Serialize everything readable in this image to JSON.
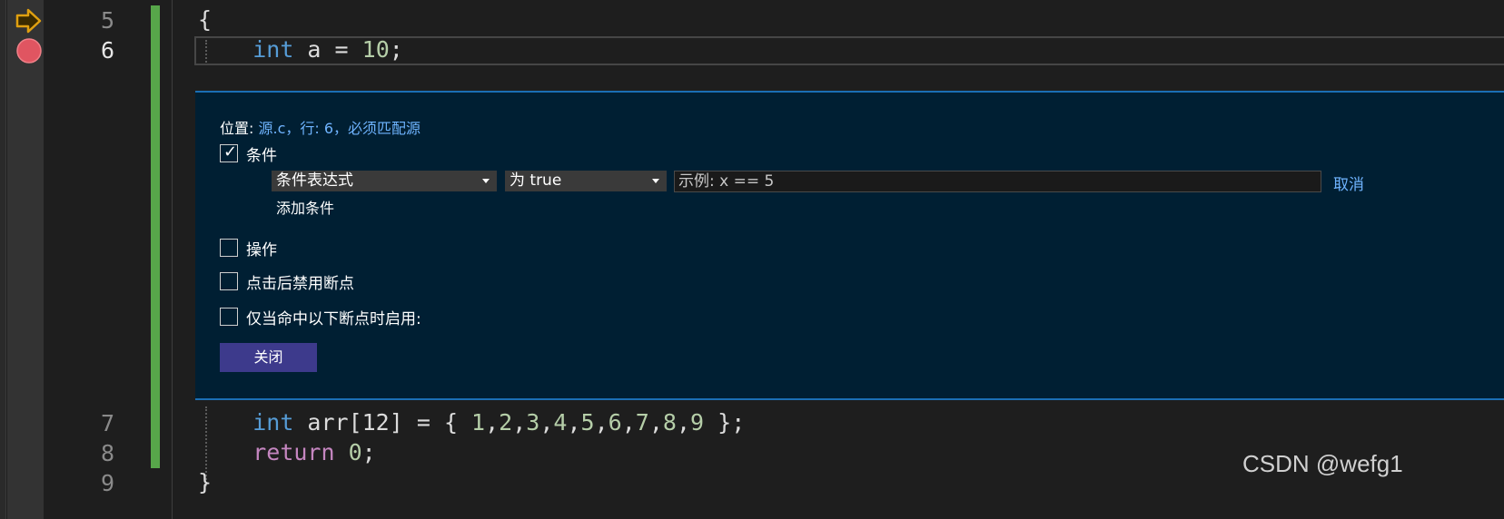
{
  "line_numbers": {
    "l5": "5",
    "l6": "6",
    "l7": "7",
    "l8": "8",
    "l9": "9"
  },
  "code": {
    "l5": "{",
    "l6": {
      "kw": "int",
      "rest": " a = ",
      "num": "10",
      "end": ";"
    },
    "l7": {
      "kw": "int",
      "rest": " arr[12] = { ",
      "nums": [
        "1",
        "2",
        "3",
        "4",
        "5",
        "6",
        "7",
        "8",
        "9"
      ],
      "end": " };"
    },
    "l8": {
      "kw": "return",
      "rest": " ",
      "num": "0",
      "end": ";"
    },
    "l9": "}"
  },
  "breakpoint_settings": {
    "location_label": "位置:",
    "location_link": "源.c，行: 6，必须匹配源",
    "condition": {
      "checked": true,
      "label": "条件"
    },
    "condition_type": "条件表达式",
    "condition_value": "为 true",
    "expression_placeholder": "示例: x == 5",
    "cancel_label": "取消",
    "add_condition_label": "添加条件",
    "action": {
      "checked": false,
      "label": "操作"
    },
    "disable_after_hit": {
      "checked": false,
      "label": "点击后禁用断点"
    },
    "only_enable_when_hit": {
      "checked": false,
      "label": "仅当命中以下断点时启用:"
    },
    "close_label": "关闭"
  },
  "watermark": "CSDN @wefg1",
  "colors": {
    "keyword": "#569cd6",
    "control_keyword": "#c586c0",
    "number": "#b5cea8",
    "accent": "#3d3a8c",
    "breakpoint": "#e05561",
    "change_bar": "#57a64a"
  },
  "icons": {
    "next_statement": "arrow-right-icon",
    "breakpoint": "breakpoint-circle-icon"
  }
}
